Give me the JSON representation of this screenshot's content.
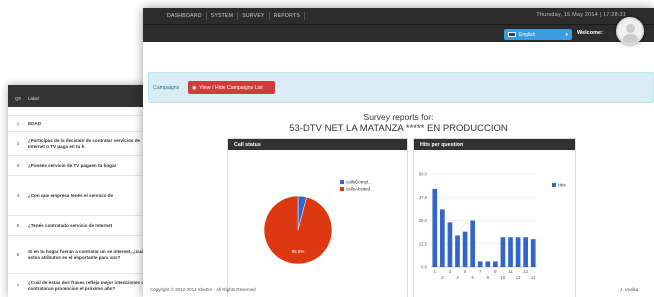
{
  "back_table": {
    "headers": [
      "Q#",
      "Label"
    ],
    "rows": [
      {
        "num": "1",
        "label": "EDAD"
      },
      {
        "num": "2",
        "label": "¿Participás de la decisión de contratar servicios de Internet o TV paga en tu h"
      },
      {
        "num": "3",
        "label": "¿Poseés servicio de TV pagaen tu hogar"
      },
      {
        "num": "4",
        "label": "¿Con que empresa tenés el servicio de"
      },
      {
        "num": "5",
        "label": "¿Tenés contratado servicio de Internet"
      },
      {
        "num": "6",
        "label": "Si en tu hogar fueran a contratar un se internet, ¿cuál de estos atributos es el importante para vos?"
      },
      {
        "num": "7",
        "label": "¿Cuál de estas dos frases refleja mejor intenciones de contratarun promocion el próximo año?"
      }
    ]
  },
  "navbar": {
    "items": [
      "DASHBOARD",
      "SYSTEM",
      "SURVEY",
      "REPORTS"
    ],
    "datetime": "Thursday, 15 May 2014 | 17:28:31"
  },
  "header": {
    "language": "English",
    "welcome": "Welcome:"
  },
  "campaigns": {
    "label": "Campaigns",
    "button": "View / Hide Campaigns List"
  },
  "report": {
    "title": "Survey reports for:",
    "subtitle": "53-DTV NET LA MATANZA ***** EN PRODUCCION"
  },
  "colors": {
    "complete": "#3366cc",
    "aborted": "#dc3912",
    "accent": "#d03c3c",
    "info_bg": "#d9edf7"
  },
  "chart_data": [
    {
      "type": "pie",
      "title": "Call status",
      "labels": [
        "callsCompl...",
        "callsAbsited..."
      ],
      "values": [
        4.1,
        95.9
      ],
      "data_labels": [
        "95.9%"
      ]
    },
    {
      "type": "bar",
      "title": "Hits per question",
      "x": [
        1,
        2,
        3,
        4,
        5,
        6,
        7,
        8,
        9,
        10,
        11,
        12,
        13,
        14
      ],
      "x_tick_labels_top": [
        "1",
        "3",
        "5",
        "7",
        "9",
        "11",
        "13"
      ],
      "x_tick_labels_bottom": [
        "2",
        "4",
        "6",
        "8",
        "10",
        "12",
        "14"
      ],
      "y_ticks": [
        "0.0",
        "12.5",
        "25.0",
        "37.5",
        "50.0"
      ],
      "ylim": [
        0,
        50
      ],
      "series": [
        {
          "name": "Hits",
          "values": [
            42,
            31,
            24,
            17,
            19,
            25,
            3,
            3,
            3,
            16,
            16,
            16,
            16,
            15
          ]
        }
      ]
    }
  ],
  "footer": {
    "left": "Copyright © 2012-2014 Xbetter - All Rights Reserved",
    "right": "J. Vedika"
  }
}
